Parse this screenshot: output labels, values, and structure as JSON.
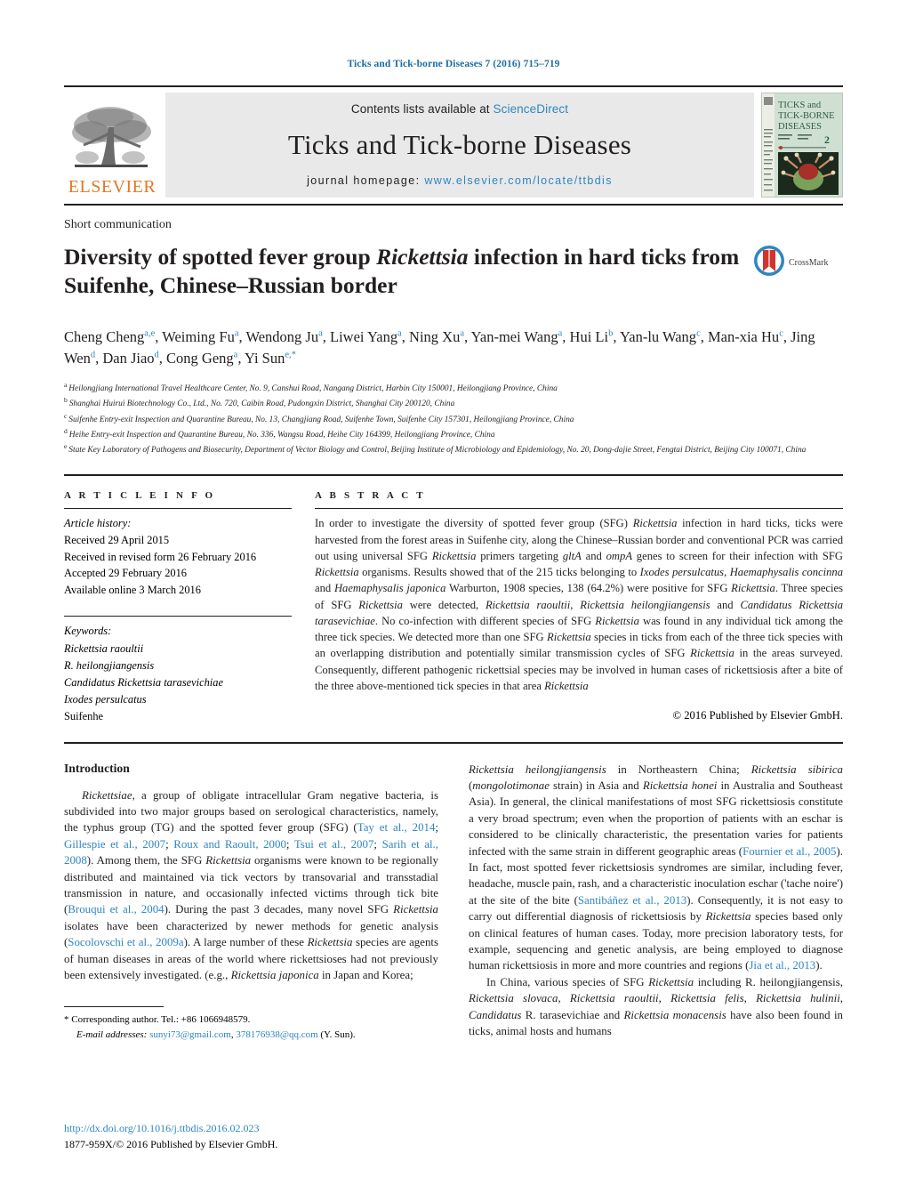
{
  "runhead": "Ticks and Tick-borne Diseases 7 (2016) 715–719",
  "masthead": {
    "contents_prefix": "Contents lists available at ",
    "contents_link": "ScienceDirect",
    "journal_title": "Ticks and Tick-borne Diseases",
    "homepage_prefix": "journal homepage: ",
    "homepage_url": "www.elsevier.com/locate/ttbdis",
    "publisher_word": "ELSEVIER",
    "cover": {
      "line1": "TICKS and",
      "line2": "TICK-BORNE",
      "line3": "DISEASES",
      "issue_number": "2"
    }
  },
  "article": {
    "section_category": "Short communication",
    "title_part1": "Diversity of spotted fever group ",
    "title_italic": "Rickettsia",
    "title_part2": " infection in hard ticks from Suifenhe, Chinese–Russian border",
    "crossmark_label": "CrossMark",
    "authors_line1": "Cheng Cheng",
    "authors_line1_sup": "a,e",
    "authors": [
      {
        "name": "Cheng Cheng",
        "sup": "a,e"
      },
      {
        "name": "Weiming Fu",
        "sup": "a"
      },
      {
        "name": "Wendong Ju",
        "sup": "a"
      },
      {
        "name": "Liwei Yang",
        "sup": "a"
      },
      {
        "name": "Ning Xu",
        "sup": "a"
      },
      {
        "name": "Yan-mei Wang",
        "sup": "a"
      },
      {
        "name": "Hui Li",
        "sup": "b"
      },
      {
        "name": "Yan-lu Wang",
        "sup": "c"
      },
      {
        "name": "Man-xia Hu",
        "sup": "c"
      },
      {
        "name": "Jing Wen",
        "sup": "d"
      },
      {
        "name": "Dan Jiao",
        "sup": "d"
      },
      {
        "name": "Cong Geng",
        "sup": "a"
      },
      {
        "name": "Yi Sun",
        "sup": "e,*"
      }
    ],
    "affiliations": [
      {
        "mark": "a",
        "text": "Heilongjiang International Travel Healthcare Center, No. 9, Canshui Road, Nangang District, Harbin City 150001, Heilongjiang Province, China"
      },
      {
        "mark": "b",
        "text": "Shanghai Huirui Biotechnology Co., Ltd., No. 720, Caibin Road, Pudongxin District, Shanghai City 200120, China"
      },
      {
        "mark": "c",
        "text": "Suifenhe Entry-exit Inspection and Quarantine Bureau, No. 13, Changjiang Road, Suifenhe Town, Suifenhe City 157301, Heilongjiang Province, China"
      },
      {
        "mark": "d",
        "text": "Heihe Entry-exit Inspection and Quarantine Bureau, No. 336, Wangsu Road, Heihe City 164399, Heilongjiang Province, China"
      },
      {
        "mark": "e",
        "text": "State Key Laboratory of Pathogens and Biosecurity, Department of Vector Biology and Control, Beijing Institute of Microbiology and Epidemiology, No. 20, Dong-dajie Street, Fengtai District, Beijing City 100071, China"
      }
    ]
  },
  "article_info": {
    "heading": "A R T I C L E    I N F O",
    "history_label": "Article history:",
    "history": [
      "Received 29 April 2015",
      "Received in revised form 26 February 2016",
      "Accepted 29 February 2016",
      "Available online 3 March 2016"
    ],
    "keywords_label": "Keywords:",
    "keywords": [
      "Rickettsia raoultii",
      "R. heilongjiangensis",
      "Candidatus Rickettsia tarasevichiae",
      "Ixodes persulcatus",
      "Suifenhe"
    ]
  },
  "abstract": {
    "heading": "A B S T R A C T",
    "text": "In order to investigate the diversity of spotted fever group (SFG) Rickettsia infection in hard ticks, ticks were harvested from the forest areas in Suifenhe city, along the Chinese–Russian border and conventional PCR was carried out using universal SFG Rickettsia primers targeting gltA and ompA genes to screen for their infection with SFG Rickettsia organisms. Results showed that of the 215 ticks belonging to Ixodes persulcatus, Haemaphysalis concinna and Haemaphysalis japonica Warburton, 1908 species, 138 (64.2%) were positive for SFG Rickettsia. Three species of SFG Rickettsia were detected, Rickettsia raoultii, Rickettsia heilongjiangensis and Candidatus Rickettsia tarasevichiae. No co-infection with different species of SFG Rickettsia was found in any individual tick among the three tick species. We detected more than one SFG Rickettsia species in ticks from each of the three tick species with an overlapping distribution and potentially similar transmission cycles of SFG Rickettsia in the areas surveyed. Consequently, different pathogenic rickettsial species may be involved in human cases of rickettsiosis after a bite of the three above-mentioned tick species in that area Rickettsia",
    "copyright": "© 2016 Published by Elsevier GmbH."
  },
  "body": {
    "intro_heading": "Introduction",
    "left_paragraph": "Rickettsiae, a group of obligate intracellular Gram negative bacteria, is subdivided into two major groups based on serological characteristics, namely, the typhus group (TG) and the spotted fever group (SFG) (Tay et al., 2014; Gillespie et al., 2007; Roux and Raoult, 2000; Tsui et al., 2007; Sarih et al., 2008). Among them, the SFG Rickettsia organisms were known to be regionally distributed and maintained via tick vectors by transovarial and transstadial transmission in nature, and occasionally infected victims through tick bite (Brouqui et al., 2004). During the past 3 decades, many novel SFG Rickettsia isolates have been characterized by newer methods for genetic analysis (Socolovschi et al., 2009a). A large number of these Rickettsia species are agents of human diseases in areas of the world where rickettsioses had not previously been extensively investigated. (e.g., Rickettsia japonica in Japan and Korea;",
    "right_paragraph_1": "Rickettsia heilongjiangensis in Northeastern China; Rickettsia sibirica (mongolotimonae strain) in Asia and Rickettsia honei in Australia and Southeast Asia). In general, the clinical manifestations of most SFG rickettsiosis constitute a very broad spectrum; even when the proportion of patients with an eschar is considered to be clinically characteristic, the presentation varies for patients infected with the same strain in different geographic areas (Fournier et al., 2005). In fact, most spotted fever rickettsiosis syndromes are similar, including fever, headache, muscle pain, rash, and a characteristic inoculation eschar ('tache noire') at the site of the bite (Santibáñez et al., 2013). Consequently, it is not easy to carry out differential diagnosis of rickettsiosis by Rickettsia species based only on clinical features of human cases. Today, more precision laboratory tests, for example, sequencing and genetic analysis, are being employed to diagnose human rickettsiosis in more and more countries and regions (Jia et al., 2013).",
    "right_paragraph_2": "In China, various species of SFG Rickettsia including R. heilongjiangensis, Rickettsia slovaca, Rickettsia raoultii, Rickettsia felis, Rickettsia hulinii, Candidatus R. tarasevichiae and Rickettsia monacensis have also been found in ticks, animal hosts and humans"
  },
  "footnotes": {
    "corresponding": "* Corresponding author. Tel.: +86 1066948579.",
    "email_label": "E-mail addresses:",
    "email1": "sunyi73@gmail.com",
    "email2": "378176938@qq.com",
    "email_suffix": "(Y. Sun).",
    "doi": "http://dx.doi.org/10.1016/j.ttbdis.2016.02.023",
    "issn": "1877-959X/© 2016 Published by Elsevier GmbH."
  },
  "colors": {
    "link": "#2e86c1",
    "elsevier_orange": "#e87722",
    "rule": "#231f20"
  }
}
